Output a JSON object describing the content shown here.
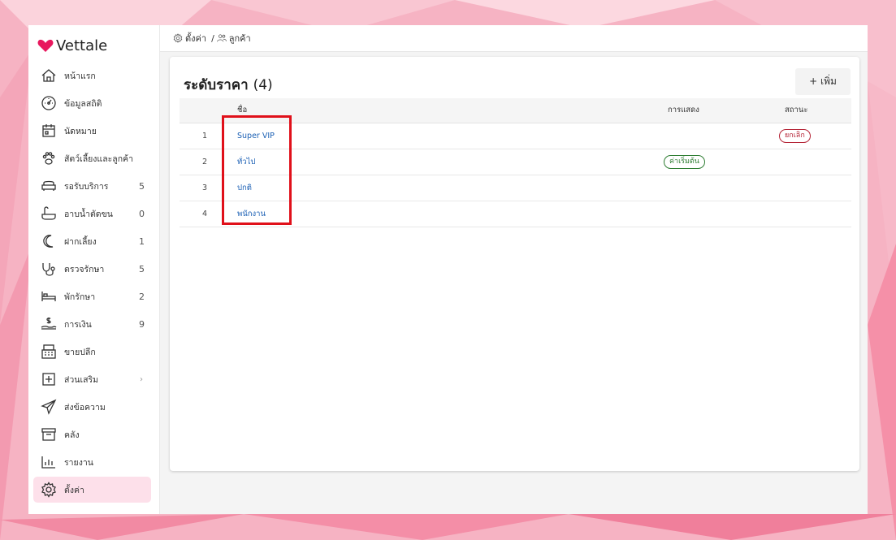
{
  "app": {
    "brand": "Vettale",
    "brand_color": "#e8175d"
  },
  "breadcrumb": {
    "settings": "ตั้งค่า",
    "separator": "/",
    "customers": "ลูกค้า"
  },
  "sidebar": {
    "items": [
      {
        "label": "หน้าแรก",
        "icon": "home-icon",
        "count": ""
      },
      {
        "label": "ข้อมูลสถิติ",
        "icon": "dashboard-icon",
        "count": ""
      },
      {
        "label": "นัดหมาย",
        "icon": "calendar-icon",
        "count": ""
      },
      {
        "label": "สัตว์เลี้ยงและลูกค้า",
        "icon": "paw-icon",
        "count": ""
      },
      {
        "label": "รอรับบริการ",
        "icon": "couch-icon",
        "count": "5"
      },
      {
        "label": "อาบน้ำตัดขน",
        "icon": "bathtub-icon",
        "count": "0"
      },
      {
        "label": "ฝากเลี้ยง",
        "icon": "moon-icon",
        "count": "1"
      },
      {
        "label": "ตรวจรักษา",
        "icon": "stethoscope-icon",
        "count": "5"
      },
      {
        "label": "พักรักษา",
        "icon": "bed-icon",
        "count": "2"
      },
      {
        "label": "การเงิน",
        "icon": "money-hand-icon",
        "count": "9"
      },
      {
        "label": "ขายปลีก",
        "icon": "cash-register-icon",
        "count": ""
      },
      {
        "label": "ส่วนเสริม",
        "icon": "plus-box-icon",
        "count": "",
        "chevron": "›"
      },
      {
        "label": "ส่งข้อความ",
        "icon": "send-icon",
        "count": ""
      },
      {
        "label": "คลัง",
        "icon": "archive-icon",
        "count": ""
      },
      {
        "label": "รายงาน",
        "icon": "bar-chart-icon",
        "count": ""
      },
      {
        "label": "ตั้งค่า",
        "icon": "gear-icon",
        "count": "",
        "active": true
      }
    ]
  },
  "card": {
    "title": "ระดับราคา",
    "count": "(4)",
    "add_label": "+ เพิ่ม",
    "columns": {
      "name": "ชื่อ",
      "display": "การแสดง",
      "status": "สถานะ"
    },
    "rows": [
      {
        "index": "1",
        "name": "Super VIP",
        "display": "",
        "status": "ยกเลิก"
      },
      {
        "index": "2",
        "name": "ทั่วไป",
        "display": "ค่าเริ่มต้น",
        "status": ""
      },
      {
        "index": "3",
        "name": "ปกติ",
        "display": "",
        "status": ""
      },
      {
        "index": "4",
        "name": "พนักงาน",
        "display": "",
        "status": ""
      }
    ]
  },
  "colors": {
    "active_bg": "#fde0ea",
    "link": "#1a5fb4",
    "status_cancel": "#b42335",
    "default_badge": "#2e7d32",
    "highlight_box": "#e0101a"
  }
}
